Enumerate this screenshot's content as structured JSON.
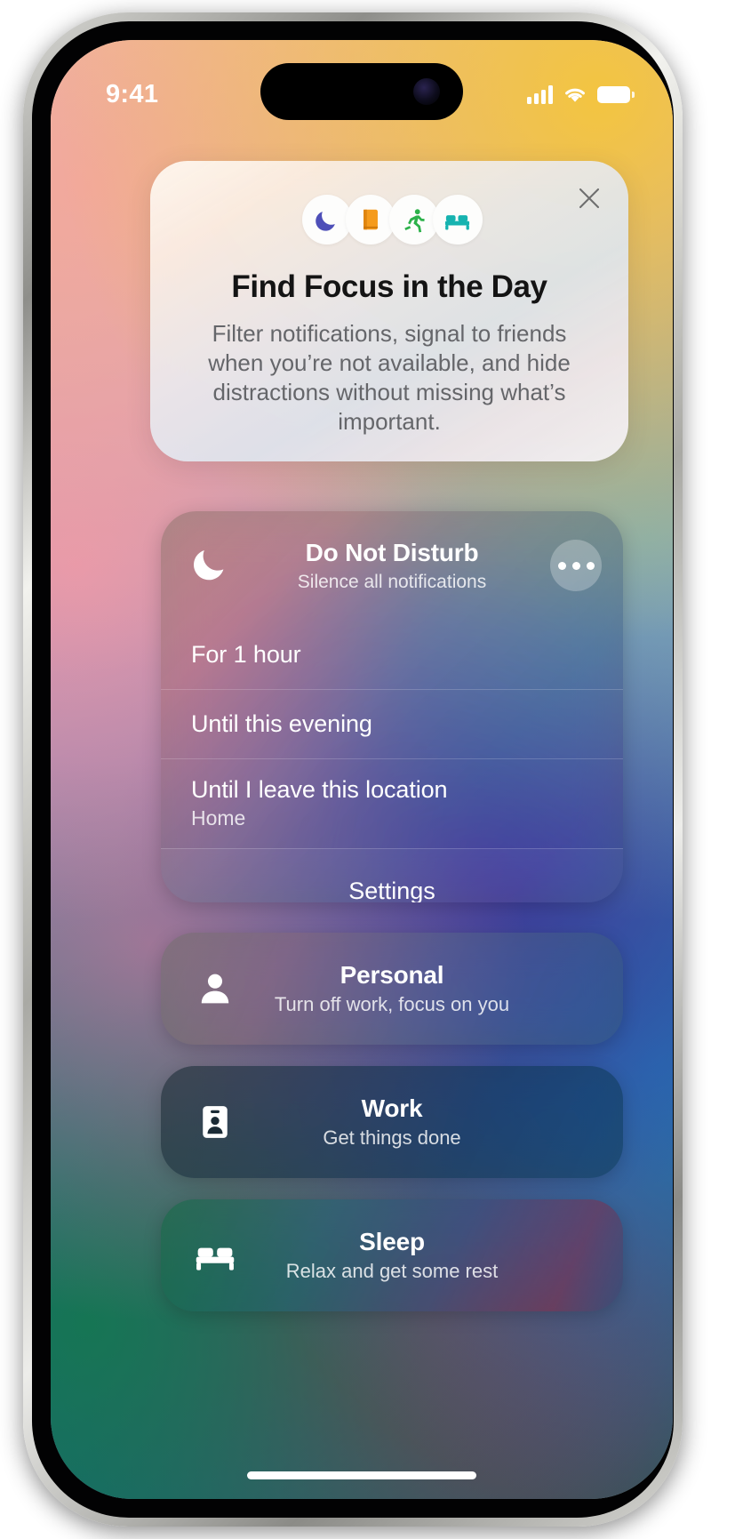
{
  "status_bar": {
    "time": "9:41",
    "cellular_icon": "cellular-signal-icon",
    "wifi_icon": "wifi-icon",
    "battery_icon": "battery-icon"
  },
  "promo_card": {
    "close_icon": "close-icon",
    "title": "Find Focus in the Day",
    "body": "Filter notifications, signal to friends when you’re not available, and hide distractions without missing what’s important.",
    "chips": [
      {
        "icon": "crescent-moon-icon",
        "color": "#4e4fb8",
        "name": "do-not-disturb-chip"
      },
      {
        "icon": "book-icon",
        "color": "#f59b1c",
        "name": "reading-chip"
      },
      {
        "icon": "running-person-icon",
        "color": "#2cb14a",
        "name": "fitness-chip"
      },
      {
        "icon": "bed-icon",
        "color": "#17b3b0",
        "name": "sleep-chip"
      }
    ]
  },
  "do_not_disturb": {
    "icon": "crescent-moon-icon",
    "title": "Do Not Disturb",
    "subtitle": "Silence all notifications",
    "more_icon": "ellipsis-icon",
    "options": [
      {
        "label": "For 1 hour",
        "sub": ""
      },
      {
        "label": "Until this evening",
        "sub": ""
      },
      {
        "label": "Until I leave this location",
        "sub": "Home"
      }
    ],
    "settings_label": "Settings"
  },
  "focus_modes": [
    {
      "icon": "person-icon",
      "title": "Personal",
      "subtitle": "Turn off work, focus on you"
    },
    {
      "icon": "id-badge-icon",
      "title": "Work",
      "subtitle": "Get things done"
    },
    {
      "icon": "bed-icon",
      "title": "Sleep",
      "subtitle": "Relax and get some rest"
    }
  ],
  "colors": {
    "chip_moon": "#4e4fb8",
    "chip_book": "#f59b1c",
    "chip_run": "#2cb14a",
    "chip_bed": "#17b3b0",
    "title_text": "#141414",
    "body_text": "#65666a"
  }
}
